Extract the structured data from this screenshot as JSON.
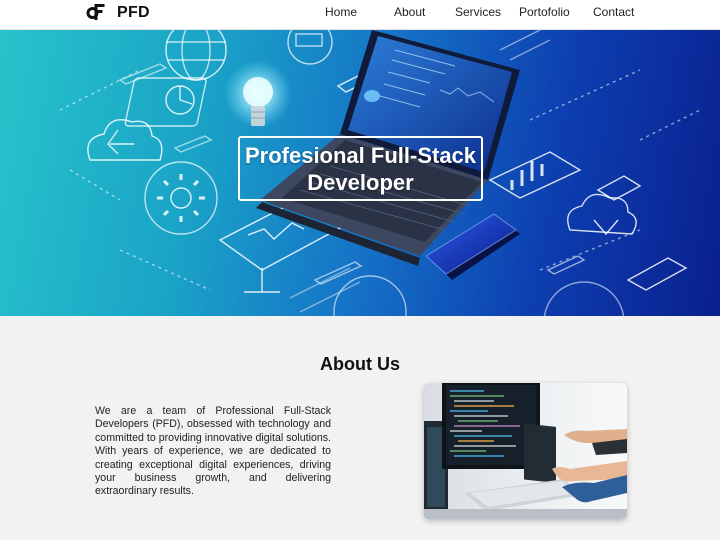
{
  "brand": {
    "name": "PFD"
  },
  "nav": {
    "items": [
      {
        "label": "Home"
      },
      {
        "label": "About"
      },
      {
        "label": "Services"
      },
      {
        "label": "Portofolio"
      },
      {
        "label": "Contact"
      }
    ]
  },
  "hero": {
    "title": "Profesional Full-Stack Developer"
  },
  "about": {
    "heading": "About Us",
    "body": "We are a team of Professional Full-Stack Developers (PFD), obsessed with technology and committed to providing innovative digital solutions. With years of experience, we are dedicated to creating exceptional digital experiences, driving your business growth, and delivering extraordinary results."
  },
  "colors": {
    "hero_start": "#27c3cb",
    "hero_end": "#0a1f8e",
    "header_bg": "#ffffff",
    "page_bg": "#f2f2f2"
  }
}
